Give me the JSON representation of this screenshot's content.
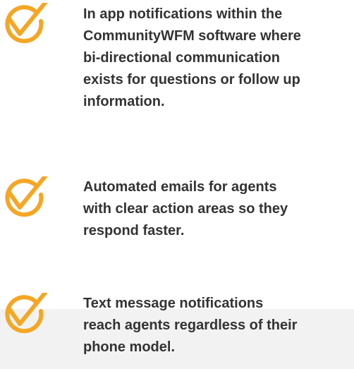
{
  "accent_color": "#f5a623",
  "features": [
    {
      "icon": "checkmark-circle-icon",
      "text": "In app notifications within the\nCommunityWFM software where\nbi-directional communication\nexists for questions or follow up\ninformation."
    },
    {
      "icon": "checkmark-circle-icon",
      "text": "Automated emails for agents\nwith clear action areas so they\nrespond faster."
    },
    {
      "icon": "checkmark-circle-icon",
      "text": "Text message notifications\nreach agents regardless of their\nphone model."
    }
  ]
}
